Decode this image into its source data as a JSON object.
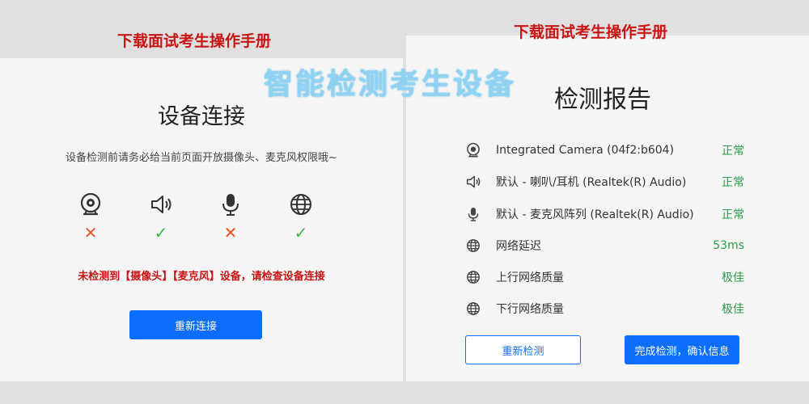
{
  "manual_link": "下载面试考生操作手册",
  "banner": "智能检测考生设备",
  "connect": {
    "title": "设备连接",
    "notice": "设备检测前请务必给当前页面开放摄像头、麦克风权限哦~",
    "devices": [
      {
        "icon": "camera-icon",
        "status": "✕",
        "ok": false
      },
      {
        "icon": "speaker-icon",
        "status": "✓",
        "ok": true
      },
      {
        "icon": "microphone-icon",
        "status": "✕",
        "ok": false
      },
      {
        "icon": "globe-icon",
        "status": "✓",
        "ok": true
      }
    ],
    "warning": "未检测到【摄像头】【麦克风】设备，请检查设备连接",
    "reconnect_label": "重新连接"
  },
  "report": {
    "title": "检测报告",
    "rows": [
      {
        "icon": "camera-icon",
        "label": "Integrated Camera (04f2:b604)",
        "status": "正常"
      },
      {
        "icon": "speaker-icon",
        "label": "默认 - 喇叭/耳机 (Realtek(R) Audio)",
        "status": "正常"
      },
      {
        "icon": "microphone-icon",
        "label": "默认 - 麦克风阵列 (Realtek(R) Audio)",
        "status": "正常"
      },
      {
        "icon": "globe-icon",
        "label": "网络延迟",
        "status": "53ms"
      },
      {
        "icon": "globe-icon",
        "label": "上行网络质量",
        "status": "极佳"
      },
      {
        "icon": "globe-icon",
        "label": "下行网络质量",
        "status": "极佳"
      }
    ],
    "redetect_label": "重新检测",
    "finish_label": "完成检测，确认信息"
  },
  "colors": {
    "accent": "#0d6efd",
    "error": "#c81414",
    "success": "#2a9a46",
    "banner": "#8fd2f2"
  }
}
